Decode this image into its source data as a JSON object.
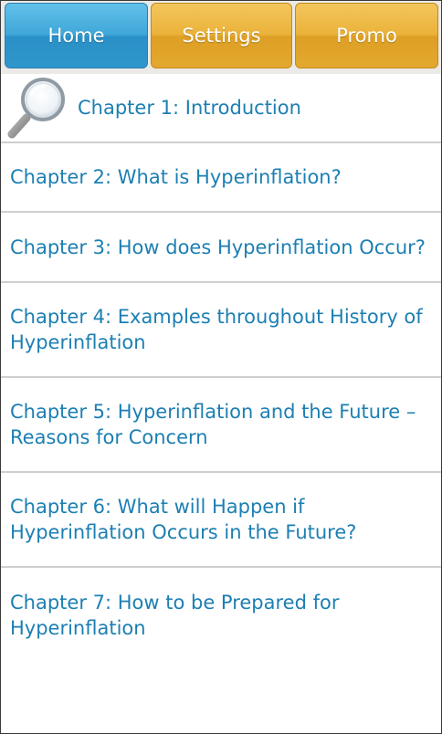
{
  "tabs": [
    {
      "label": "Home",
      "selected": true
    },
    {
      "label": "Settings",
      "selected": false
    },
    {
      "label": "Promo",
      "selected": false
    }
  ],
  "chapters": [
    "Chapter 1: Introduction",
    "Chapter 2: What is Hyperinflation?",
    "Chapter 3: How does Hyperinflation Occur?",
    "Chapter 4: Examples throughout History of Hyperinflation",
    "Chapter 5: Hyperinflation and the Future – Reasons for Concern",
    "Chapter 6: What will Happen if Hyperinflation Occurs in the Future?",
    "Chapter 7: How to be Prepared for Hyperinflation"
  ],
  "icons": {
    "search": "search-icon"
  },
  "colors": {
    "link": "#1c7fb3",
    "tab_active": "#3fa7d9",
    "tab_inactive": "#eab23a",
    "divider": "#cfcfcf"
  }
}
